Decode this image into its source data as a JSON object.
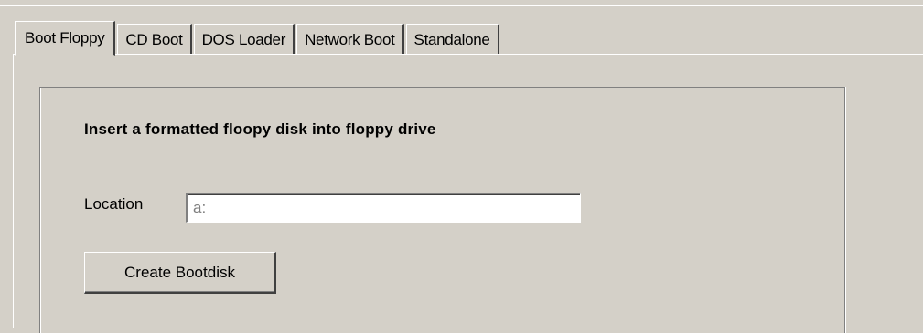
{
  "tabs": [
    {
      "label": "Boot Floppy",
      "active": true
    },
    {
      "label": "CD Boot",
      "active": false
    },
    {
      "label": "DOS Loader",
      "active": false
    },
    {
      "label": "Network Boot",
      "active": false
    },
    {
      "label": "Standalone",
      "active": false
    }
  ],
  "panel": {
    "instruction": "Insert a formatted floopy disk into floppy drive",
    "location_label": "Location",
    "location_value": "a:",
    "create_button_label": "Create Bootdisk"
  },
  "colors": {
    "background": "#d4d0c8",
    "highlight": "#ffffff",
    "shadow": "#808080",
    "dark_shadow": "#404040",
    "input_text": "#808080"
  }
}
